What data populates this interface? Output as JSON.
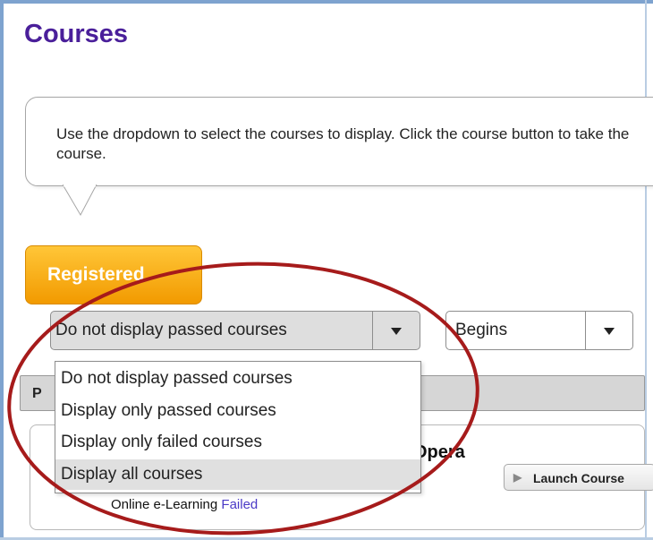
{
  "page": {
    "title": "Courses",
    "instruction": "Use the dropdown to select the courses to display. Click the course button to take the course."
  },
  "tabs": {
    "registered_label": "Registered"
  },
  "filters": {
    "course_filter_value": "Do not display passed courses",
    "options": [
      "Do not display passed courses",
      "Display only passed courses",
      "Display only failed courses",
      "Display all courses"
    ],
    "highlighted_option": "Display all courses",
    "match_mode_value": "Begins"
  },
  "list_header": {
    "label": "P"
  },
  "course": {
    "name": "Opera",
    "launch_label": "Launch Course",
    "type": "Online e-Learning",
    "status": "Failed"
  },
  "icons": {
    "dropdown_arrow": "triangle-down-icon",
    "launch": "play-icon"
  },
  "colors": {
    "title": "#4a1f9a",
    "tab": "#f5a500",
    "annotation": "#a61b1b",
    "status": "#4a3ac6"
  }
}
